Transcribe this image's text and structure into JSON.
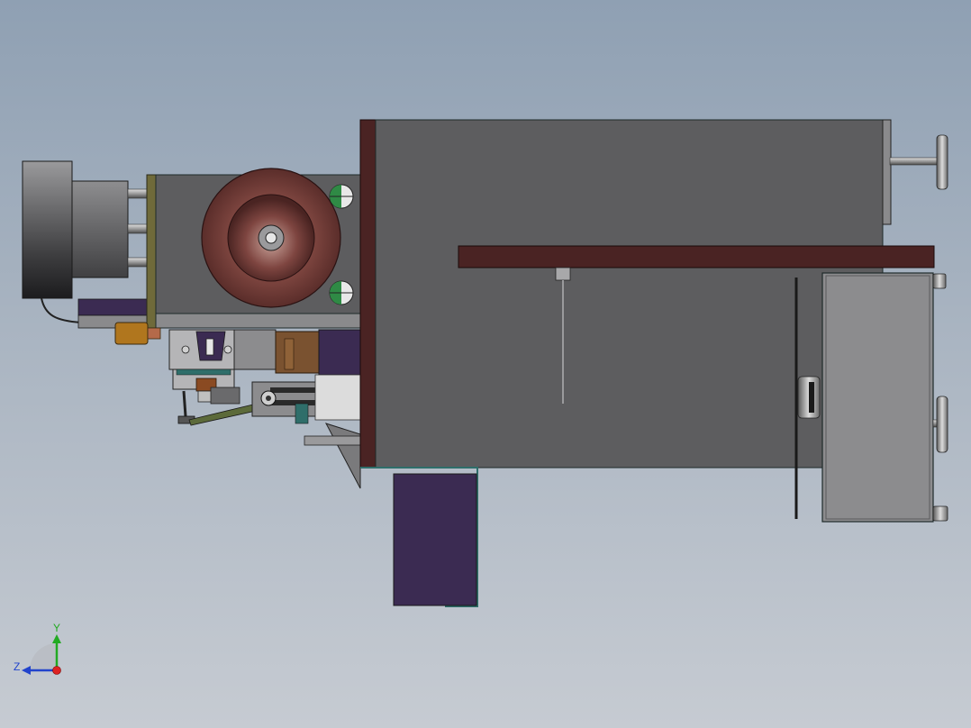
{
  "view": {
    "background_top": "#8fa0b3",
    "background_bottom": "#c6cbd2"
  },
  "model": {
    "colors": {
      "housing_gray": "#5d5d5f",
      "housing_dark": "#4f4f52",
      "brown_plate": "#4a2323",
      "purple_block": "#3b2b52",
      "copper_block": "#7a5230",
      "light_gray_box": "#8c8c8e",
      "outline": "#1e2a2a",
      "teal_edge": "#2f6e6a",
      "axis_y": "#22aa22",
      "axis_z": "#2244cc",
      "axis_x": "#dd2222"
    }
  },
  "triad": {
    "y_label": "Y",
    "z_label": "Z"
  }
}
